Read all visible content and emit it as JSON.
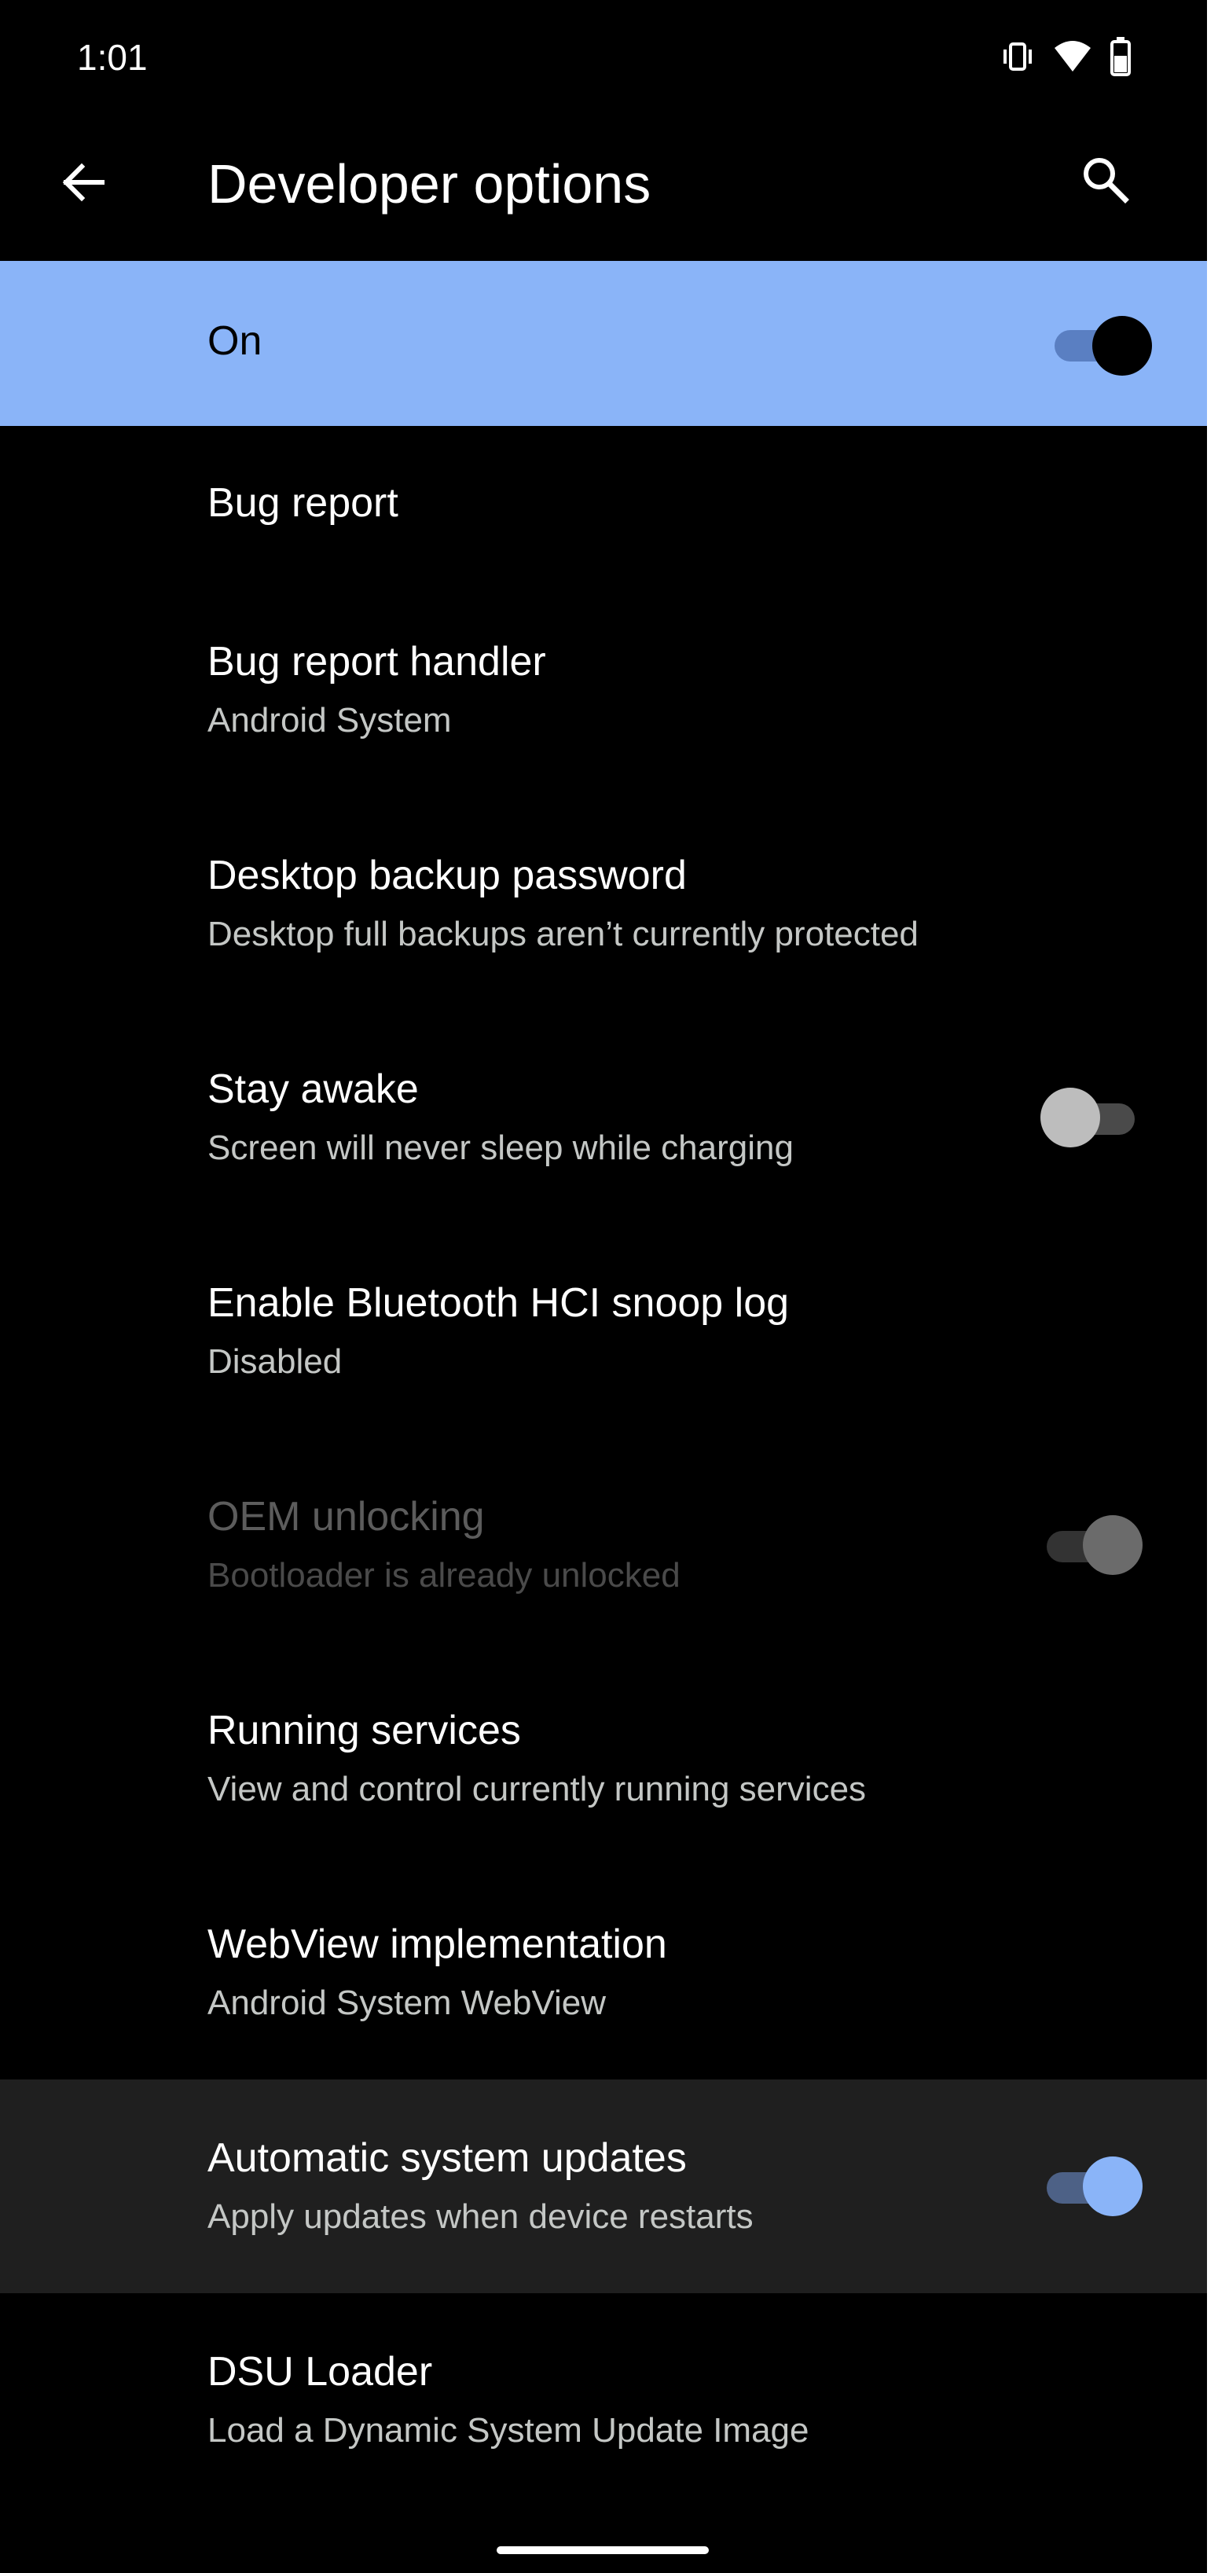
{
  "status_bar": {
    "time": "1:01",
    "icons": [
      "vibrate-icon",
      "wifi-icon",
      "battery-icon"
    ]
  },
  "app_bar": {
    "title": "Developer options",
    "back_icon": "arrow-back-icon",
    "search_icon": "search-icon"
  },
  "master_switch": {
    "label": "On",
    "checked": true,
    "background": "#8ab4f8"
  },
  "settings": [
    {
      "title": "Bug report",
      "summary": ""
    },
    {
      "title": "Bug report handler",
      "summary": "Android System"
    },
    {
      "title": "Desktop backup password",
      "summary": "Desktop full backups aren’t currently protected"
    },
    {
      "title": "Stay awake",
      "summary": "Screen will never sleep while charging",
      "switch": "off"
    },
    {
      "title": "Enable Bluetooth HCI snoop log",
      "summary": "Disabled"
    },
    {
      "title": "OEM unlocking",
      "summary": "Bootloader is already unlocked",
      "switch": "on",
      "enabled": false
    },
    {
      "title": "Running services",
      "summary": "View and control currently running services"
    },
    {
      "title": "WebView implementation",
      "summary": "Android System WebView"
    },
    {
      "title": "Automatic system updates",
      "summary": "Apply updates when device restarts",
      "switch": "on",
      "highlighted": true
    },
    {
      "title": "DSU Loader",
      "summary": "Load a Dynamic System Update Image"
    }
  ],
  "colors": {
    "accent": "#8ab4f8",
    "background": "#000000",
    "highlight_row": "#1f1f1f",
    "summary_text": "#c4c7c5"
  }
}
